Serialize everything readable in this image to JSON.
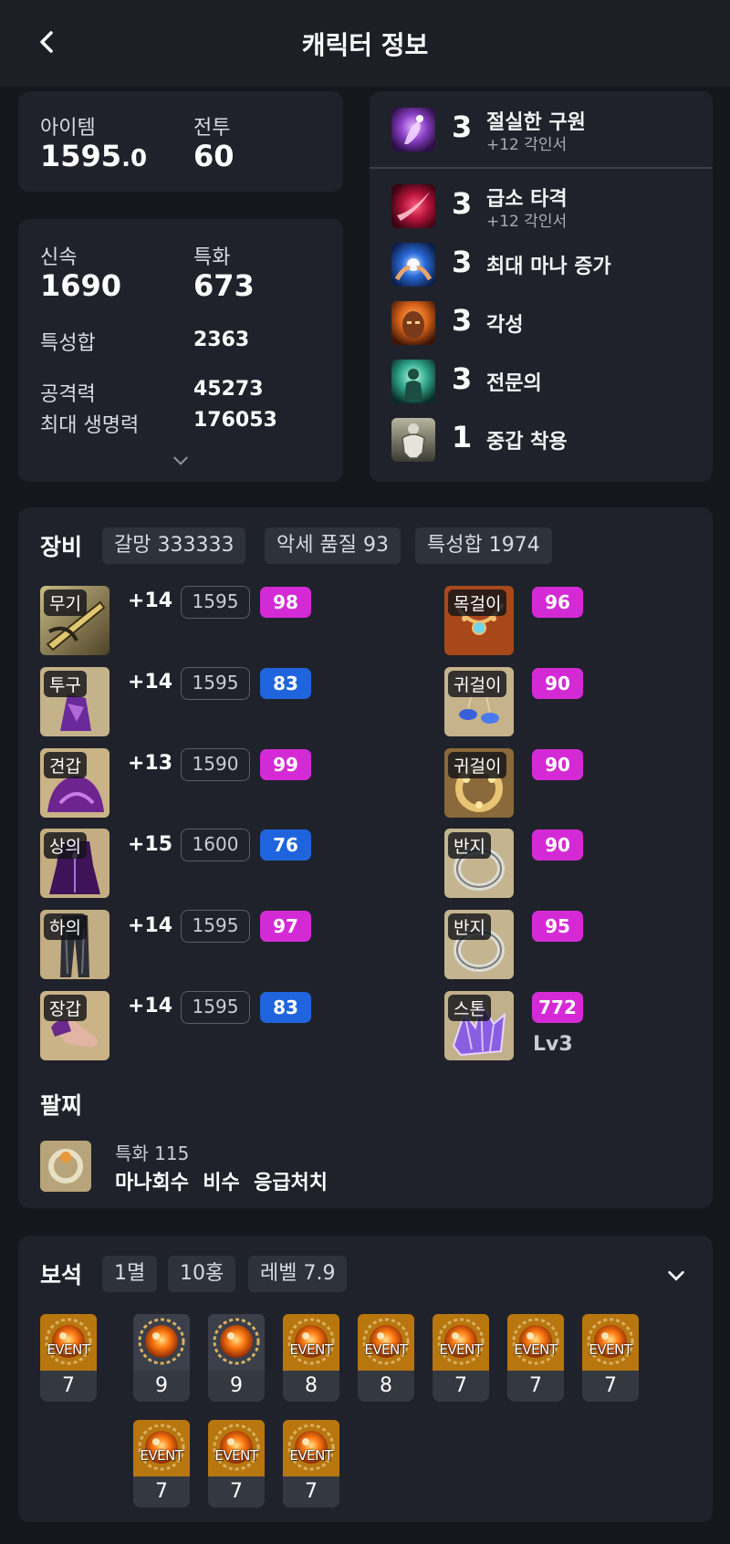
{
  "header": {
    "title": "캐릭터 정보"
  },
  "stats": {
    "item_label": "아이템",
    "item_value": "1595",
    "item_decimal": ".0",
    "combat_label": "전투",
    "combat_value": "60",
    "swift_label": "신속",
    "swift_value": "1690",
    "spec_label": "특화",
    "spec_value": "673",
    "total_label": "특성합",
    "total_value": "2363",
    "attack_label": "공격력",
    "attack_value": "45273",
    "hp_label": "최대 생명력",
    "hp_value": "176053"
  },
  "engravings": [
    {
      "level": "3",
      "name": "절실한 구원",
      "sub": "+12 각인서",
      "icon": "praying-figure-icon",
      "color": "#8a3fc4"
    },
    {
      "level": "3",
      "name": "급소 타격",
      "sub": "+12 각인서",
      "icon": "slash-strike-icon",
      "color": "#b3133a"
    },
    {
      "level": "3",
      "name": "최대 마나 증가",
      "sub": "",
      "icon": "mana-hands-icon",
      "color": "#2a6ad8"
    },
    {
      "level": "3",
      "name": "각성",
      "sub": "",
      "icon": "awakened-face-icon",
      "color": "#d8621a"
    },
    {
      "level": "3",
      "name": "전문의",
      "sub": "",
      "icon": "healer-figure-icon",
      "color": "#2fa58a"
    },
    {
      "level": "1",
      "name": "중갑 착용",
      "sub": "",
      "icon": "heavy-armor-icon",
      "color": "#8a8a7a"
    }
  ],
  "equipment": {
    "title": "장비",
    "chips": [
      "갈망 333333",
      "악세 품질 93",
      "특성합 1974"
    ],
    "armor": [
      {
        "slot": "무기",
        "plus": "+14",
        "ilvl": "1595",
        "quality": "98",
        "qtype": "purple",
        "icon": "weapon-icon"
      },
      {
        "slot": "투구",
        "plus": "+14",
        "ilvl": "1595",
        "quality": "83",
        "qtype": "blue",
        "icon": "helmet-icon"
      },
      {
        "slot": "견갑",
        "plus": "+13",
        "ilvl": "1590",
        "quality": "99",
        "qtype": "purple",
        "icon": "shoulder-icon"
      },
      {
        "slot": "상의",
        "plus": "+15",
        "ilvl": "1600",
        "quality": "76",
        "qtype": "blue",
        "icon": "chest-icon"
      },
      {
        "slot": "하의",
        "plus": "+14",
        "ilvl": "1595",
        "quality": "97",
        "qtype": "purple",
        "icon": "pants-icon"
      },
      {
        "slot": "장갑",
        "plus": "+14",
        "ilvl": "1595",
        "quality": "83",
        "qtype": "blue",
        "icon": "gloves-icon"
      }
    ],
    "accessories": [
      {
        "slot": "목걸이",
        "quality": "96",
        "icon": "necklace-icon"
      },
      {
        "slot": "귀걸이",
        "quality": "90",
        "icon": "earring-icon"
      },
      {
        "slot": "귀걸이",
        "quality": "90",
        "icon": "earring-icon"
      },
      {
        "slot": "반지",
        "quality": "90",
        "icon": "ring-icon"
      },
      {
        "slot": "반지",
        "quality": "95",
        "icon": "ring-icon"
      },
      {
        "slot": "스톤",
        "quality": "772",
        "level": "Lv3",
        "icon": "ability-stone-icon"
      }
    ],
    "bracelet": {
      "title": "팔찌",
      "line1": "특화 115",
      "line2": "마나회수  비수  응급처치"
    }
  },
  "gems": {
    "title": "보석",
    "chips": [
      "1멸",
      "10홍",
      "레벨 7.9"
    ],
    "event_label": "EVENT",
    "items": [
      {
        "level": "7",
        "event": true
      },
      {
        "level": "9",
        "event": false
      },
      {
        "level": "9",
        "event": false
      },
      {
        "level": "8",
        "event": true
      },
      {
        "level": "8",
        "event": true
      },
      {
        "level": "7",
        "event": true
      },
      {
        "level": "7",
        "event": true
      },
      {
        "level": "7",
        "event": true
      },
      {
        "level": "7",
        "event": true
      },
      {
        "level": "7",
        "event": true
      },
      {
        "level": "7",
        "event": true
      }
    ]
  },
  "colors": {
    "background": "#15171c",
    "card": "#1f222a",
    "chip": "#2e323b",
    "quality_purple": "#d42ad6",
    "quality_blue": "#1f64dd"
  }
}
